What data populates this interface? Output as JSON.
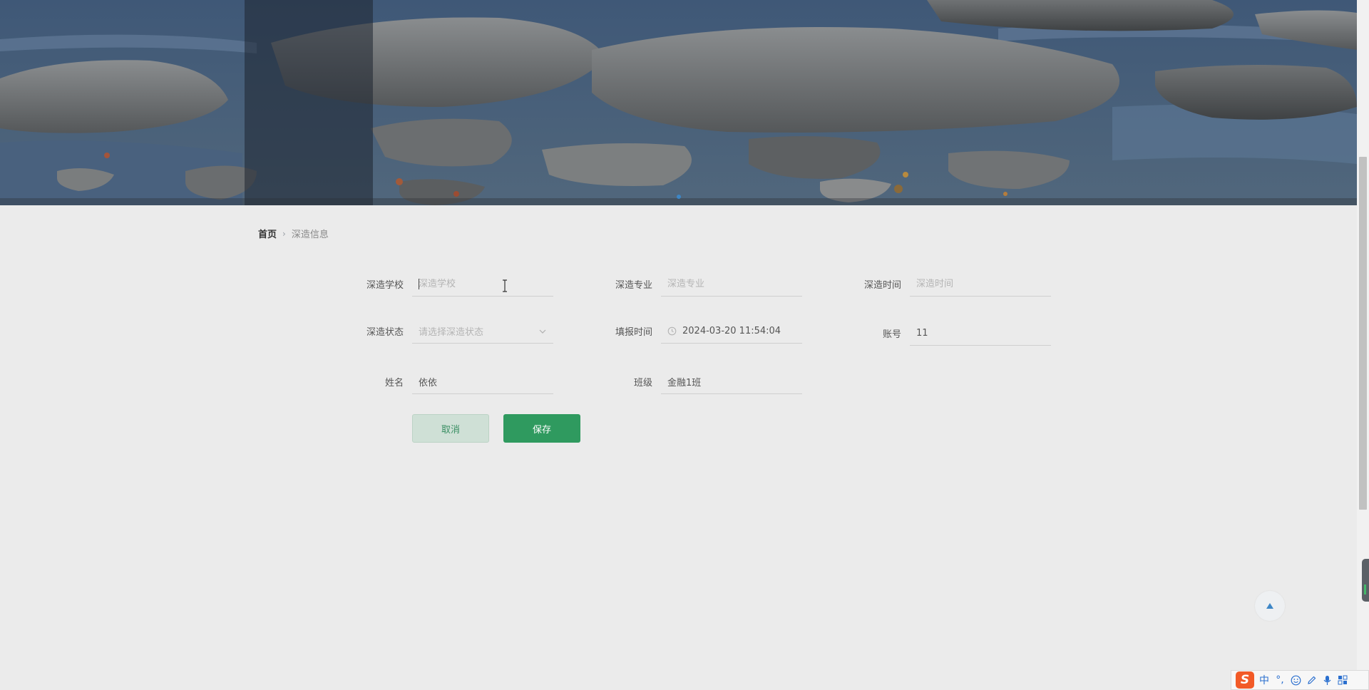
{
  "breadcrumb": {
    "home": "首页",
    "separator": "›",
    "current": "深造信息"
  },
  "form": {
    "school": {
      "label": "深造学校",
      "placeholder": "深造学校",
      "value": ""
    },
    "major": {
      "label": "深造专业",
      "placeholder": "深造专业",
      "value": ""
    },
    "study_time": {
      "label": "深造时间",
      "placeholder": "深造时间",
      "value": ""
    },
    "status": {
      "label": "深造状态",
      "placeholder": "请选择深造状态",
      "value": ""
    },
    "fill_time": {
      "label": "填报时间",
      "value": "2024-03-20 11:54:04"
    },
    "account": {
      "label": "账号",
      "value": "11"
    },
    "name": {
      "label": "姓名",
      "value": "依依"
    },
    "class": {
      "label": "班级",
      "value": "金融1班"
    }
  },
  "buttons": {
    "cancel": "取消",
    "save": "保存"
  },
  "ime": {
    "logo": "S",
    "mode": "中",
    "punct": "°,",
    "items": [
      "emoji-icon",
      "pen-icon",
      "mic-icon",
      "grid-icon"
    ]
  },
  "colors": {
    "primary": "#2f9a5f",
    "cancel_bg": "#cfe0d6",
    "page_bg": "#ebebeb",
    "ime_logo": "#f25a27"
  }
}
